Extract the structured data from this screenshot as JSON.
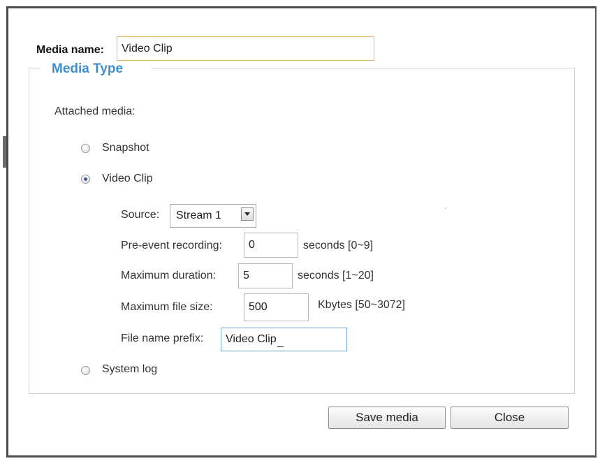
{
  "media_name": {
    "label": "Media name:",
    "value": "Video Clip"
  },
  "media_type": {
    "legend": "Media Type",
    "attached_label": "Attached media:",
    "options": [
      {
        "label": "Snapshot",
        "checked": false
      },
      {
        "label": "Video Clip",
        "checked": true
      },
      {
        "label": "System log",
        "checked": false
      }
    ]
  },
  "video_clip": {
    "source": {
      "label": "Source:",
      "value": "Stream 1"
    },
    "pre_event": {
      "label": "Pre-event recording:",
      "value": "0",
      "unit": "seconds [0~9]"
    },
    "max_duration": {
      "label": "Maximum duration:",
      "value": "5",
      "unit": "seconds [1~20]"
    },
    "max_file_size": {
      "label": "Maximum file size:",
      "value": "500",
      "unit": "Kbytes [50~3072]"
    },
    "file_prefix": {
      "label": "File name prefix:",
      "value": "Video Clip"
    }
  },
  "buttons": {
    "save": "Save media",
    "close": "Close"
  },
  "colors": {
    "legend": "#3f8fce",
    "frame": "#4a4a4a",
    "focus_orange": "#e8b462",
    "focus_blue": "#6fa3d6"
  }
}
